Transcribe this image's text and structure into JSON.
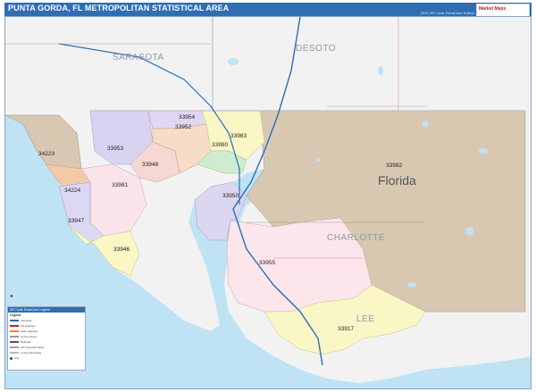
{
  "header": {
    "title": "PUNTA GORDA, FL METROPOLITAN STATISTICAL AREA",
    "edition": "2020 ZIP Code ExtraColor Edition",
    "brand": "Market Maps"
  },
  "map": {
    "state_label": "Florida",
    "counties": [
      "SARASOTA",
      "DESOTO",
      "CHARLOTTE",
      "LEE"
    ],
    "zip_labels": [
      "33954",
      "33952",
      "33983",
      "33980",
      "33953",
      "33948",
      "34223",
      "33982",
      "34224",
      "33981",
      "33950",
      "33947",
      "33946",
      "33955",
      "33917"
    ],
    "colors": {
      "water": "#bfe3f5",
      "land_outside": "#f2f2f2",
      "zip_33982": "#d8c8b2",
      "zip_33955": "#fce6ec",
      "zip_33950": "#dcd6f0",
      "zip_33917": "#fbf6c6",
      "zip_33981": "#fbe3ea",
      "zip_33947": "#ddd8f2",
      "zip_33946": "#fbf6c6",
      "zip_34224": "#f4c9a8",
      "zip_34223": "#d8c8b2",
      "zip_33953": "#d9d2f0",
      "zip_33948": "#f6d7d2",
      "zip_33954": "#e2d7f3",
      "zip_33952": "#f7dcc6",
      "zip_33983": "#fbf6c6",
      "zip_33980": "#cfeccf",
      "county_line": "#b7b7c5",
      "highway": "#2a6fb5"
    }
  },
  "legend": {
    "header": "ZIP Code ExtraColor Legend",
    "title": "Legend",
    "rows": [
      "Interstate",
      "US Highway",
      "State Highway",
      "County Road",
      "Railroad",
      "ZIP Code Boundary",
      "County Boundary",
      "City"
    ]
  }
}
